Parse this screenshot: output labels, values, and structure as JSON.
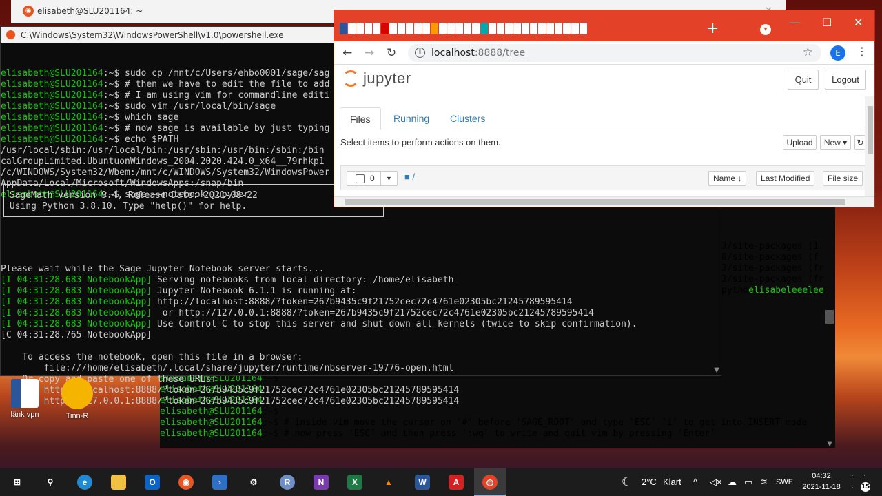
{
  "ubuntu": {
    "title": "elisabeth@SLU201164: ~"
  },
  "powershell": {
    "title": "C:\\Windows\\System32\\WindowsPowerShell\\v1.0\\powershell.exe",
    "lines": [
      {
        "prompt": "elisabeth@SLU201164",
        "rest": ":~$ sudo cp /mnt/c/Users/ehbo0001/sage/sag"
      },
      {
        "prompt": "elisabeth@SLU201164",
        "rest": ":~$ # then we have to edit the file to add"
      },
      {
        "prompt": "elisabeth@SLU201164",
        "rest": ":~$ # I am using vim for commandline editi"
      },
      {
        "prompt": "elisabeth@SLU201164",
        "rest": ":~$ sudo vim /usr/local/bin/sage"
      },
      {
        "prompt": "elisabeth@SLU201164",
        "rest": ":~$ which sage"
      },
      {
        "prompt": "elisabeth@SLU201164",
        "rest": ":~$ # now sage is available by just typing"
      },
      {
        "prompt": "elisabeth@SLU201164",
        "rest": ":~$ echo $PATH"
      },
      {
        "prompt": "",
        "rest": "/usr/local/sbin:/usr/local/bin:/usr/sbin:/usr/bin:/sbin:/bin"
      },
      {
        "prompt": "",
        "rest": "calGroupLimited.UbuntuonWindows_2004.2020.424.0_x64__79rhkp1"
      },
      {
        "prompt": "",
        "rest": "/c/WINDOWS/System32/Wbem:/mnt/c/WINDOWS/System32/WindowsPower"
      },
      {
        "prompt": "",
        "rest": "AppData/Local/Microsoft/WindowsApps:/snap/bin"
      },
      {
        "prompt": "elisabeth@SLU201164",
        "rest": ":~$ sage --notebook jupyter"
      }
    ],
    "sage_box": [
      " SageMath version 9.4, Release Date: 2021-08-22",
      " Using Python 3.8.10. Type \"help()\" for help."
    ],
    "server_lines": [
      {
        "tag": "",
        "rest": "Please wait while the Sage Jupyter Notebook server starts..."
      },
      {
        "tag": "[I 04:31:28.683 NotebookApp]",
        "rest": " Serving notebooks from local directory: /home/elisabeth"
      },
      {
        "tag": "[I 04:31:28.683 NotebookApp]",
        "rest": " Jupyter Notebook 6.1.1 is running at:"
      },
      {
        "tag": "[I 04:31:28.683 NotebookApp]",
        "rest": " http://localhost:8888/?token=267b9435c9f21752cec72c4761e02305bc21245789595414"
      },
      {
        "tag": "[I 04:31:28.683 NotebookApp]",
        "rest": "  or http://127.0.0.1:8888/?token=267b9435c9f21752cec72c4761e02305bc21245789595414"
      },
      {
        "tag": "[I 04:31:28.683 NotebookApp]",
        "rest": " Use Control-C to stop this server and shut down all kernels (twice to skip confirmation)."
      },
      {
        "tag": "",
        "rest": "[C 04:31:28.765 NotebookApp]"
      },
      {
        "tag": "",
        "rest": ""
      },
      {
        "tag": "",
        "rest": "    To access the notebook, open this file in a browser:"
      },
      {
        "tag": "",
        "rest": "        file:///home/elisabeth/.local/share/jupyter/runtime/nbserver-19776-open.html"
      },
      {
        "tag": "",
        "rest": "    Or copy and paste one of these URLs:"
      },
      {
        "tag": "",
        "rest": "        http://localhost:8888/?token=267b9435c9f21752cec72c4761e02305bc21245789595414"
      },
      {
        "tag": "",
        "rest": "     or http://127.0.0.1:8888/?token=267b9435c9f21752cec72c4761e02305bc21245789595414"
      }
    ]
  },
  "lower_terminal": {
    "right_fragments": [
      "3/site-packages (1.",
      "",
      "8/site-packages (f",
      "",
      "3/site-packages (fr",
      "",
      "3/site-packages (fr",
      "",
      "pytho"
    ],
    "right_green": "elisabeleeelee",
    "lines": [
      {
        "prompt": "elisabeth@SLU201164",
        "rest": ":~$"
      },
      {
        "prompt": "elisabeth@SLU201164",
        "rest": ":~$"
      },
      {
        "prompt": "elisabeth@SLU201164",
        "rest": ":~$"
      },
      {
        "prompt": "elisabeth@SLU201164",
        "rest": ":~$"
      },
      {
        "prompt": "elisabeth@SLU201164",
        "rest": ":~$ # inside vim move the cursor on '#' before 'SAGE_ROOT' and type 'ESC' 'i' to get into INSERT mode"
      },
      {
        "prompt": "elisabeth@SLU201164",
        "rest": ":~$ # now press 'ESC' and then press ':wq' to write and quit vim by pressing 'Enter'"
      }
    ]
  },
  "browser": {
    "url_host": "localhost",
    "url_path": ":8888/tree",
    "profile_initial": "E",
    "jupyter": {
      "logo_text": "jupyter",
      "quit_label": "Quit",
      "logout_label": "Logout",
      "tabs": [
        "Files",
        "Running",
        "Clusters"
      ],
      "select_text": "Select items to perform actions on them.",
      "upload_label": "Upload",
      "new_label": "New ▾",
      "selected_count": "0",
      "breadcrumb": "/",
      "sort_name": "Name ↓",
      "sort_modified": "Last Modified",
      "sort_size": "File size"
    }
  },
  "desktop": {
    "icons": [
      {
        "label": "länk vpn"
      },
      {
        "label": "Tinn-R"
      }
    ]
  },
  "taskbar": {
    "weather_temp": "2°C",
    "weather_text": "Klart",
    "language": "SWE",
    "time": "04:32",
    "date": "2021-11-18",
    "notifications": "15"
  }
}
